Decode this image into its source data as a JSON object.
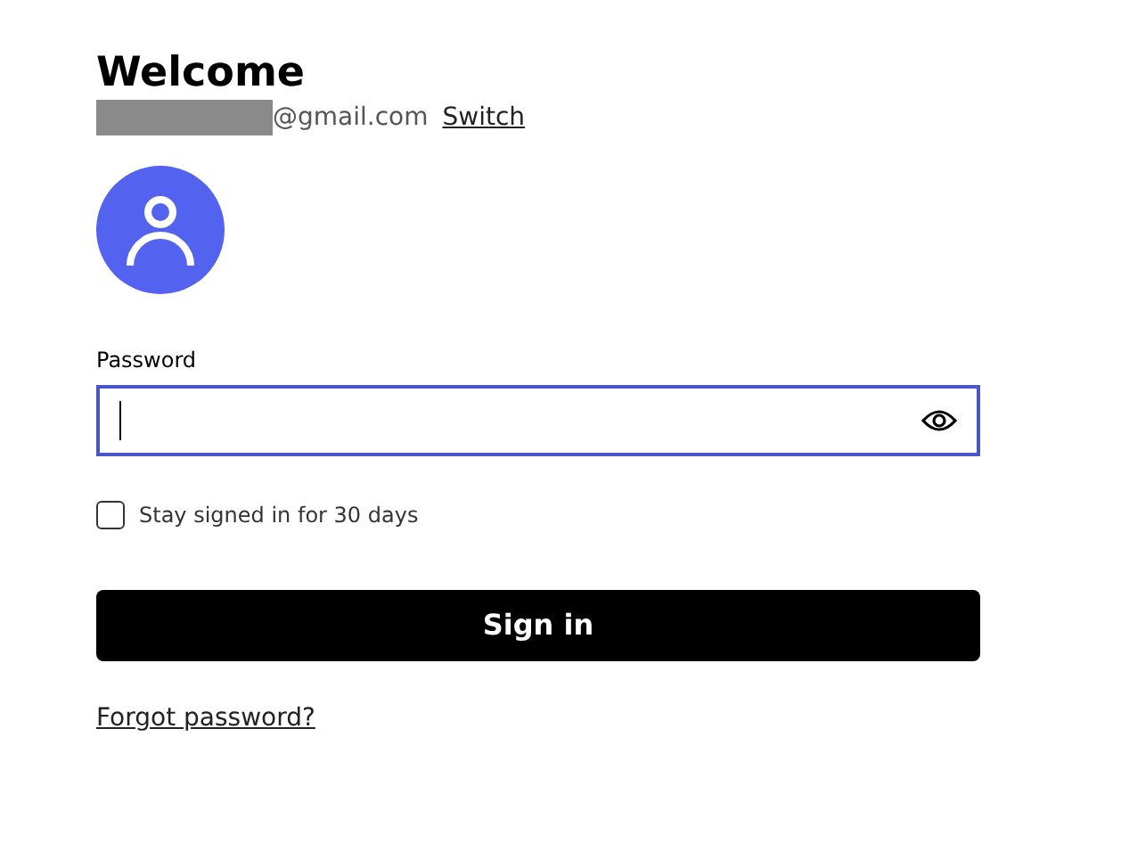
{
  "heading": "Welcome",
  "account": {
    "email": "@gmail.com",
    "switch_link": "Switch"
  },
  "password": {
    "label": "Password",
    "focused": true
  },
  "stay_signed_in": {
    "label": "Stay signed in for 30 days",
    "checked": false
  },
  "sign_in_button": "Sign in",
  "forgot_link": "Forgot password?"
}
